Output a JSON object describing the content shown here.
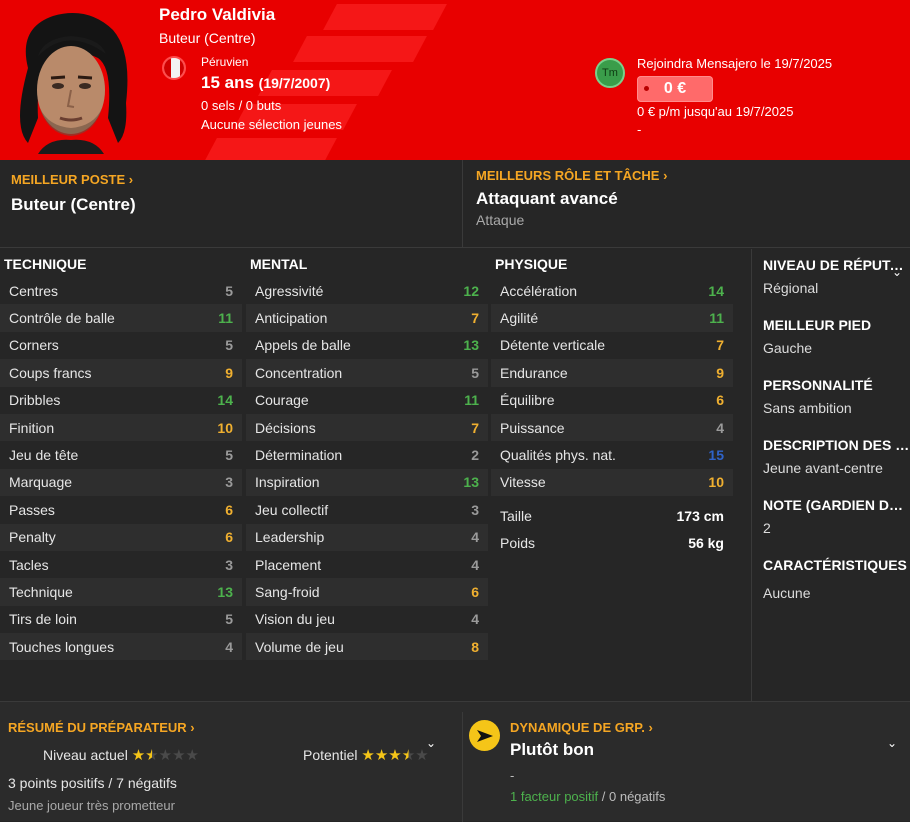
{
  "player": {
    "name": "Pedro Valdivia",
    "position": "Buteur (Centre)",
    "nationality": "Péruvien",
    "age": "15 ans",
    "birthdate": "(19/7/2007)",
    "caps": "0 sels / 0 buts",
    "youth_caps": "Aucune sélection jeunes"
  },
  "transfer": {
    "club_abbr": "Tm",
    "text": "Rejoindra Mensajero le 19/7/2025",
    "fee": "0 €",
    "wage": "0 € p/m jusqu'au 19/7/2025",
    "dash": "-"
  },
  "best_position": {
    "title": "MEILLEUR POSTE",
    "value": "Buteur (Centre)"
  },
  "best_role": {
    "title": "MEILLEURS RÔLE ET TÂCHE",
    "value": "Attaquant avancé",
    "duty": "Attaque"
  },
  "technical": {
    "title": "TECHNIQUE",
    "items": [
      {
        "label": "Centres",
        "value": "5",
        "tier": "lo"
      },
      {
        "label": "Contrôle de balle",
        "value": "11",
        "tier": "hi"
      },
      {
        "label": "Corners",
        "value": "5",
        "tier": "lo"
      },
      {
        "label": "Coups francs",
        "value": "9",
        "tier": "mid"
      },
      {
        "label": "Dribbles",
        "value": "14",
        "tier": "hi"
      },
      {
        "label": "Finition",
        "value": "10",
        "tier": "mid"
      },
      {
        "label": "Jeu de tête",
        "value": "5",
        "tier": "lo"
      },
      {
        "label": "Marquage",
        "value": "3",
        "tier": "lo"
      },
      {
        "label": "Passes",
        "value": "6",
        "tier": "mid"
      },
      {
        "label": "Penalty",
        "value": "6",
        "tier": "mid"
      },
      {
        "label": "Tacles",
        "value": "3",
        "tier": "lo"
      },
      {
        "label": "Technique",
        "value": "13",
        "tier": "hi"
      },
      {
        "label": "Tirs de loin",
        "value": "5",
        "tier": "lo"
      },
      {
        "label": "Touches longues",
        "value": "4",
        "tier": "lo"
      }
    ]
  },
  "mental": {
    "title": "MENTAL",
    "items": [
      {
        "label": "Agressivité",
        "value": "12",
        "tier": "hi"
      },
      {
        "label": "Anticipation",
        "value": "7",
        "tier": "mid"
      },
      {
        "label": "Appels de balle",
        "value": "13",
        "tier": "hi"
      },
      {
        "label": "Concentration",
        "value": "5",
        "tier": "lo"
      },
      {
        "label": "Courage",
        "value": "11",
        "tier": "hi"
      },
      {
        "label": "Décisions",
        "value": "7",
        "tier": "mid"
      },
      {
        "label": "Détermination",
        "value": "2",
        "tier": "lo"
      },
      {
        "label": "Inspiration",
        "value": "13",
        "tier": "hi"
      },
      {
        "label": "Jeu collectif",
        "value": "3",
        "tier": "lo"
      },
      {
        "label": "Leadership",
        "value": "4",
        "tier": "lo"
      },
      {
        "label": "Placement",
        "value": "4",
        "tier": "lo"
      },
      {
        "label": "Sang-froid",
        "value": "6",
        "tier": "mid"
      },
      {
        "label": "Vision du jeu",
        "value": "4",
        "tier": "lo"
      },
      {
        "label": "Volume de jeu",
        "value": "8",
        "tier": "mid"
      }
    ]
  },
  "physical": {
    "title": "PHYSIQUE",
    "items": [
      {
        "label": "Accélération",
        "value": "14",
        "tier": "hi"
      },
      {
        "label": "Agilité",
        "value": "11",
        "tier": "hi"
      },
      {
        "label": "Détente verticale",
        "value": "7",
        "tier": "mid"
      },
      {
        "label": "Endurance",
        "value": "9",
        "tier": "mid"
      },
      {
        "label": "Équilibre",
        "value": "6",
        "tier": "mid"
      },
      {
        "label": "Puissance",
        "value": "4",
        "tier": "lo"
      },
      {
        "label": "Qualités phys. nat.",
        "value": "15",
        "tier": "top"
      },
      {
        "label": "Vitesse",
        "value": "10",
        "tier": "mid"
      }
    ],
    "height_label": "Taille",
    "height": "173 cm",
    "weight_label": "Poids",
    "weight": "56 kg"
  },
  "side": {
    "reputation_title": "NIVEAU DE RÉPUTATION",
    "reputation": "Régional",
    "foot_title": "MEILLEUR PIED",
    "foot": "Gauche",
    "personality_title": "PERSONNALITÉ",
    "personality": "Sans ambition",
    "description_title": "DESCRIPTION DES MÉDIAS",
    "description": "Jeune avant-centre",
    "gk_title": "NOTE (GARDIEN DE BUT)",
    "gk": "2",
    "traits_title": "CARACTÉRISTIQUES",
    "traits": "Aucune"
  },
  "coach": {
    "title": "RÉSUMÉ DU PRÉPARATEUR",
    "current_label": "Niveau actuel",
    "current_stars": 1.5,
    "potential_label": "Potentiel",
    "potential_stars": 3.5,
    "summary": "3 points positifs / 7 négatifs",
    "note": "Jeune joueur très prometteur"
  },
  "dynamics": {
    "title": "DYNAMIQUE DE GRP.",
    "value": "Plutôt bon",
    "dash": "-",
    "positive": "1 facteur positif",
    "sep": " / ",
    "negative": "0 négatifs"
  },
  "colors": {
    "header": "#e80000",
    "accent": "#f5a623",
    "high": "#4db24d",
    "mid": "#f0b030",
    "top": "#2f63c9",
    "star": "#f5c518"
  }
}
